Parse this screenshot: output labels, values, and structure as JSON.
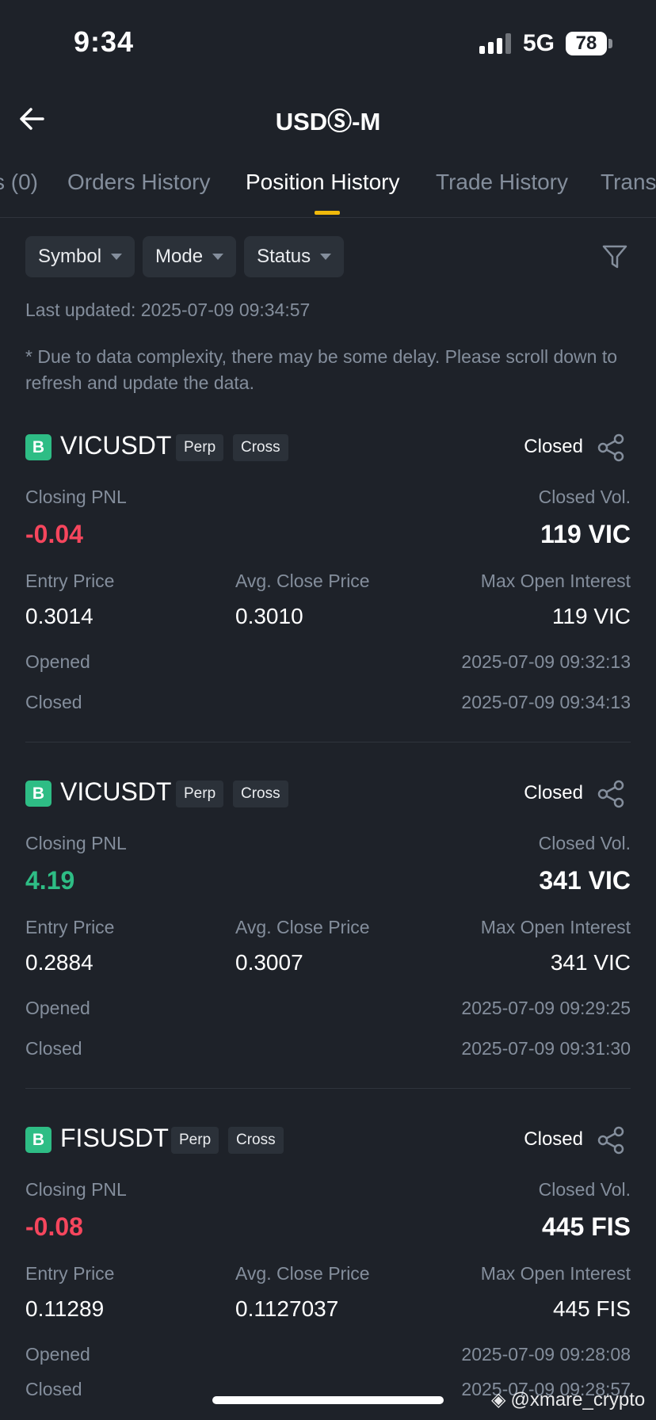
{
  "status_bar": {
    "time": "9:34",
    "network": "5G",
    "battery": "78"
  },
  "header": {
    "title": "USDⓈ-M"
  },
  "tabs": [
    {
      "label": "s (0)"
    },
    {
      "label": "Orders History"
    },
    {
      "label": "Position History"
    },
    {
      "label": "Trade History"
    },
    {
      "label": "Trans"
    }
  ],
  "filters": {
    "symbol": "Symbol",
    "mode": "Mode",
    "status": "Status"
  },
  "last_updated": "Last updated: 2025-07-09 09:34:57",
  "note": "* Due to data complexity, there may be some delay. Please scroll down to refresh and update the data.",
  "labels": {
    "closing_pnl": "Closing PNL",
    "closed_vol": "Closed Vol.",
    "entry_price": "Entry Price",
    "avg_close": "Avg. Close Price",
    "max_oi": "Max Open Interest",
    "opened": "Opened",
    "closed": "Closed"
  },
  "positions": [
    {
      "side": "B",
      "symbol": "VICUSDT",
      "tag1": "Perp",
      "tag2": "Cross",
      "status": "Closed",
      "pnl": "-0.04",
      "pnl_sign": "negative",
      "closed_vol": "119 VIC",
      "entry_price": "0.3014",
      "avg_close": "0.3010",
      "max_oi": "119 VIC",
      "opened": "2025-07-09 09:32:13",
      "closed": "2025-07-09 09:34:13"
    },
    {
      "side": "B",
      "symbol": "VICUSDT",
      "tag1": "Perp",
      "tag2": "Cross",
      "status": "Closed",
      "pnl": "4.19",
      "pnl_sign": "positive",
      "closed_vol": "341 VIC",
      "entry_price": "0.2884",
      "avg_close": "0.3007",
      "max_oi": "341 VIC",
      "opened": "2025-07-09 09:29:25",
      "closed": "2025-07-09 09:31:30"
    },
    {
      "side": "B",
      "symbol": "FISUSDT",
      "tag1": "Perp",
      "tag2": "Cross",
      "status": "Closed",
      "pnl": "-0.08",
      "pnl_sign": "negative",
      "closed_vol": "445 FIS",
      "entry_price": "0.11289",
      "avg_close": "0.1127037",
      "max_oi": "445 FIS",
      "opened": "2025-07-09 09:28:08",
      "closed": "2025-07-09 09:28:57"
    }
  ],
  "watermark": "@xmare_crypto",
  "colors": {
    "accent": "#f0b90b",
    "positive": "#2ebd85",
    "negative": "#f6465d"
  }
}
